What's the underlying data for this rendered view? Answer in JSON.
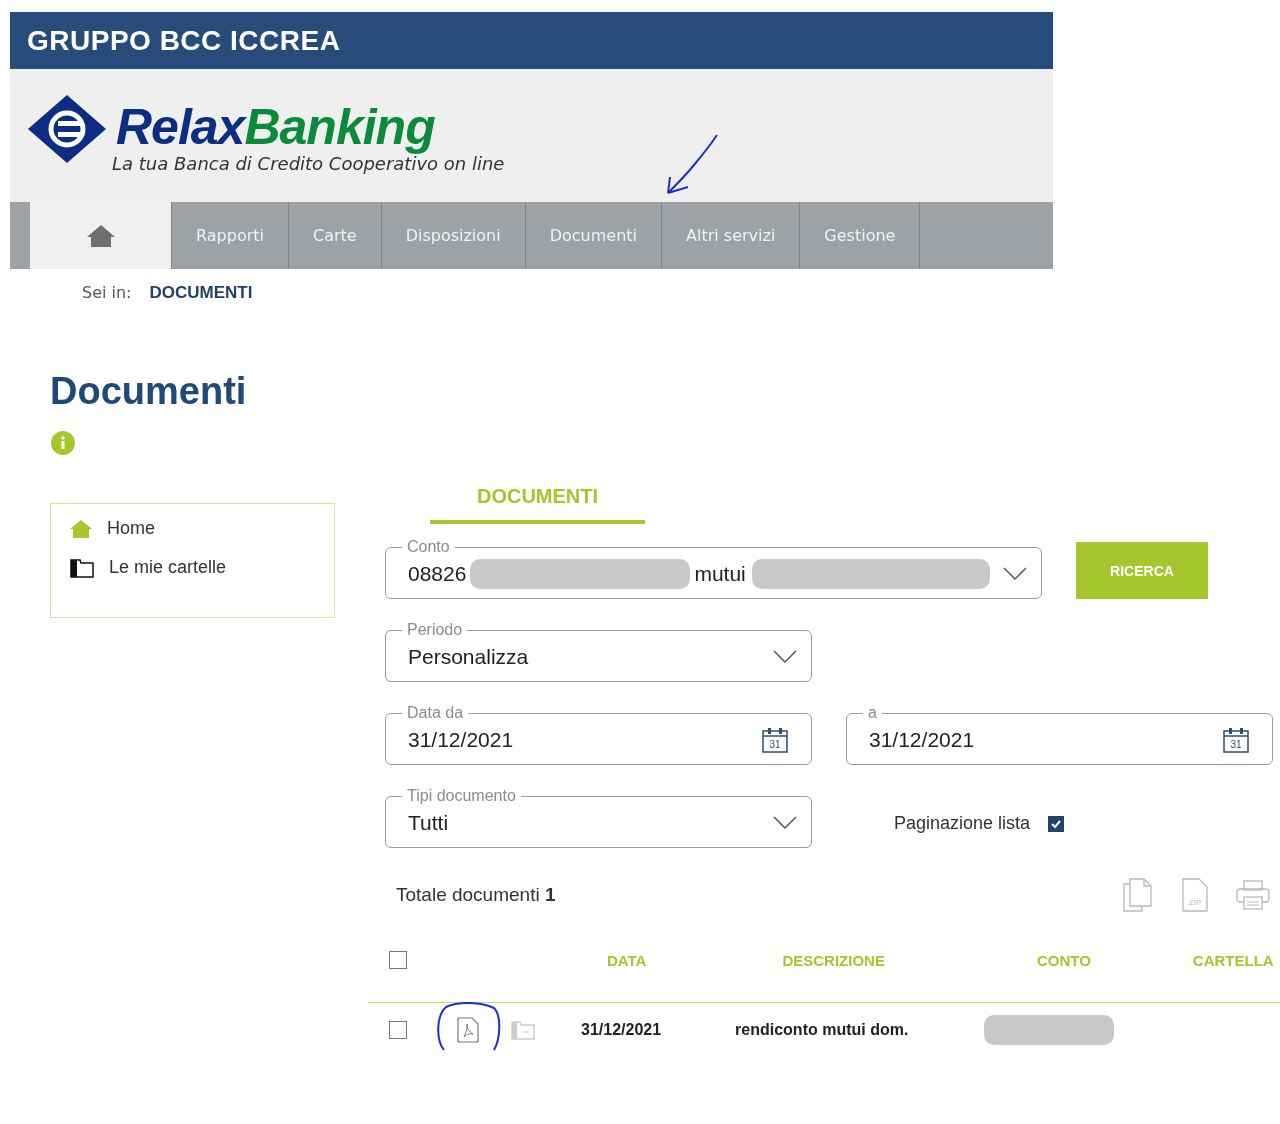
{
  "brand_bar": {
    "title": "GRUPPO BCC ICCREA"
  },
  "logo": {
    "word_parts": [
      "Relax",
      "Banking"
    ],
    "tagline": "La tua Banca di Credito Cooperativo on line"
  },
  "nav": [
    {
      "kind": "home",
      "selected": true
    },
    {
      "kind": "text",
      "label": "Rapporti",
      "selected": false
    },
    {
      "kind": "text",
      "label": "Carte",
      "selected": false
    },
    {
      "kind": "text",
      "label": "Disposizioni",
      "selected": false
    },
    {
      "kind": "text",
      "label": "Documenti",
      "selected": false
    },
    {
      "kind": "text",
      "label": "Altri servizi",
      "selected": false
    },
    {
      "kind": "text",
      "label": "Gestione",
      "selected": false
    }
  ],
  "breadcrumb": {
    "prefix": "Sei in:",
    "current": "DOCUMENTI"
  },
  "page_title": "Documenti",
  "sidebar": [
    {
      "kind": "home",
      "label": "Home"
    },
    {
      "kind": "folder",
      "label": "Le mie cartelle"
    }
  ],
  "tabs": [
    {
      "label": "DOCUMENTI",
      "selected": true
    }
  ],
  "conto": {
    "label": "Conto",
    "segments": [
      {
        "text": "08826",
        "redacted_after": true
      },
      {
        "text": "mutui",
        "redacted_after": true
      }
    ]
  },
  "search_button": "RICERCA",
  "periodo": {
    "label": "Periodo",
    "value": "Personalizza"
  },
  "date_from": {
    "label": "Data da",
    "value": "31/12/2021",
    "calendar_day": "31"
  },
  "date_to": {
    "label": "a",
    "value": "31/12/2021",
    "calendar_day": "31"
  },
  "tipi": {
    "label": "Tipi documento",
    "value": "Tutti"
  },
  "pagination": {
    "label": "Paginazione lista",
    "checked": true
  },
  "total": {
    "label": "Totale documenti",
    "count": "1"
  },
  "zip_label": "ZIP",
  "table": {
    "select_all_checked": false,
    "columns": [
      "DATA",
      "DESCRIZIONE",
      "CONTO",
      "CARTELLA"
    ],
    "rows": [
      {
        "checked": false,
        "data": "31/12/2021",
        "descrizione": "rendiconto mutui dom.",
        "conto_redacted": true
      }
    ]
  }
}
